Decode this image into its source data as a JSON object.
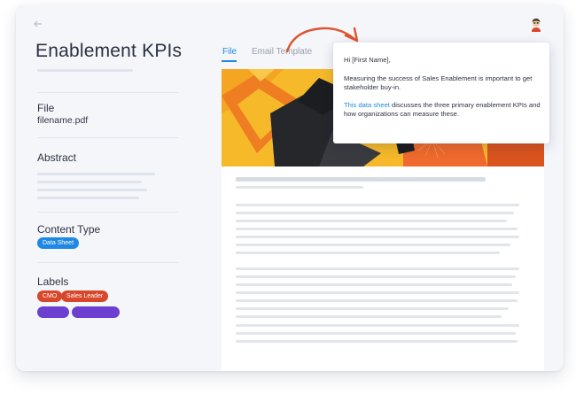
{
  "page": {
    "title": "Enablement KPIs",
    "back_icon": "arrow-left-icon",
    "avatar_icon": "user-avatar-icon"
  },
  "sidebar": {
    "file_label": "File",
    "file_name": "filename.pdf",
    "abstract_label": "Abstract",
    "content_type_label": "Content Type",
    "content_type_chip": "Data Sheet",
    "labels_label": "Labels",
    "labels": [
      "CMO",
      "Sales Leader"
    ]
  },
  "tabs": [
    {
      "label": "File",
      "active": true
    },
    {
      "label": "Email Template",
      "active": false
    }
  ],
  "popover": {
    "greeting": "Hi [First Name],",
    "paragraph1": "Measuring the success of Sales Enablement is important to get stakeholder buy-in.",
    "link_text": "This data sheet",
    "paragraph2_rest": " discusses the three primary enablement KPIs and how organizations can measure these."
  },
  "colors": {
    "accent": "#1f88e5",
    "chip_red": "#d9472b",
    "chip_purple": "#6c3fd1",
    "arrow": "#e0532f",
    "hero_yellow": "#f6b92a",
    "hero_orange": "#ef6a2c"
  }
}
